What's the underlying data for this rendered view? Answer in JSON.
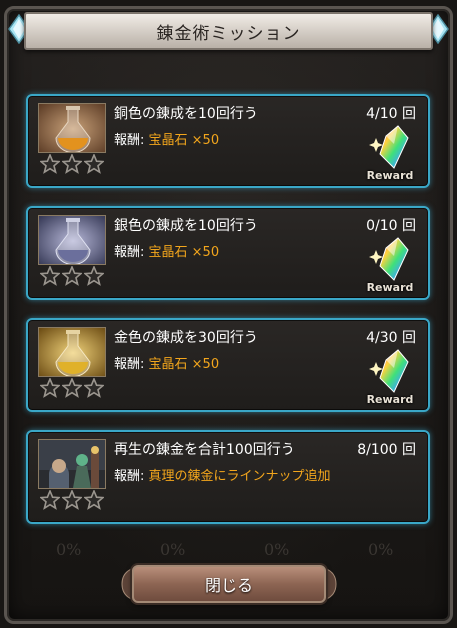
{
  "dialog": {
    "title": "錬金術ミッション",
    "close_label": "閉じる",
    "background_percent_labels": [
      "0%",
      "0%",
      "0%",
      "0%"
    ]
  },
  "reward_prefix": "報酬:",
  "reward_badge_text": "Reward",
  "missions": [
    {
      "title": "銅色の錬成を10回行う",
      "progress": "4/10 回",
      "progress_value": 4,
      "progress_total": 10,
      "reward": "宝晶石 ×50",
      "stars": 3,
      "potion_color": "#e3921e",
      "has_reward_icon": true
    },
    {
      "title": "銀色の錬成を10回行う",
      "progress": "0/10 回",
      "progress_value": 0,
      "progress_total": 10,
      "reward": "宝晶石 ×50",
      "stars": 3,
      "potion_color": "#6b6f9c",
      "has_reward_icon": true
    },
    {
      "title": "金色の錬成を30回行う",
      "progress": "4/30 回",
      "progress_value": 4,
      "progress_total": 30,
      "reward": "宝晶石 ×50",
      "stars": 3,
      "potion_color": "#e0b12a",
      "has_reward_icon": true
    },
    {
      "title": "再生の錬金を合計100回行う",
      "progress": "8/100 回",
      "progress_value": 8,
      "progress_total": 100,
      "reward": "真理の錬金にラインナップ追加",
      "stars": 3,
      "potion_color": "#4a8a6a",
      "has_reward_icon": false
    }
  ],
  "colors": {
    "accent_border": "#3aa7c7",
    "reward_text": "#f3a61c",
    "button": "#8d6553"
  }
}
